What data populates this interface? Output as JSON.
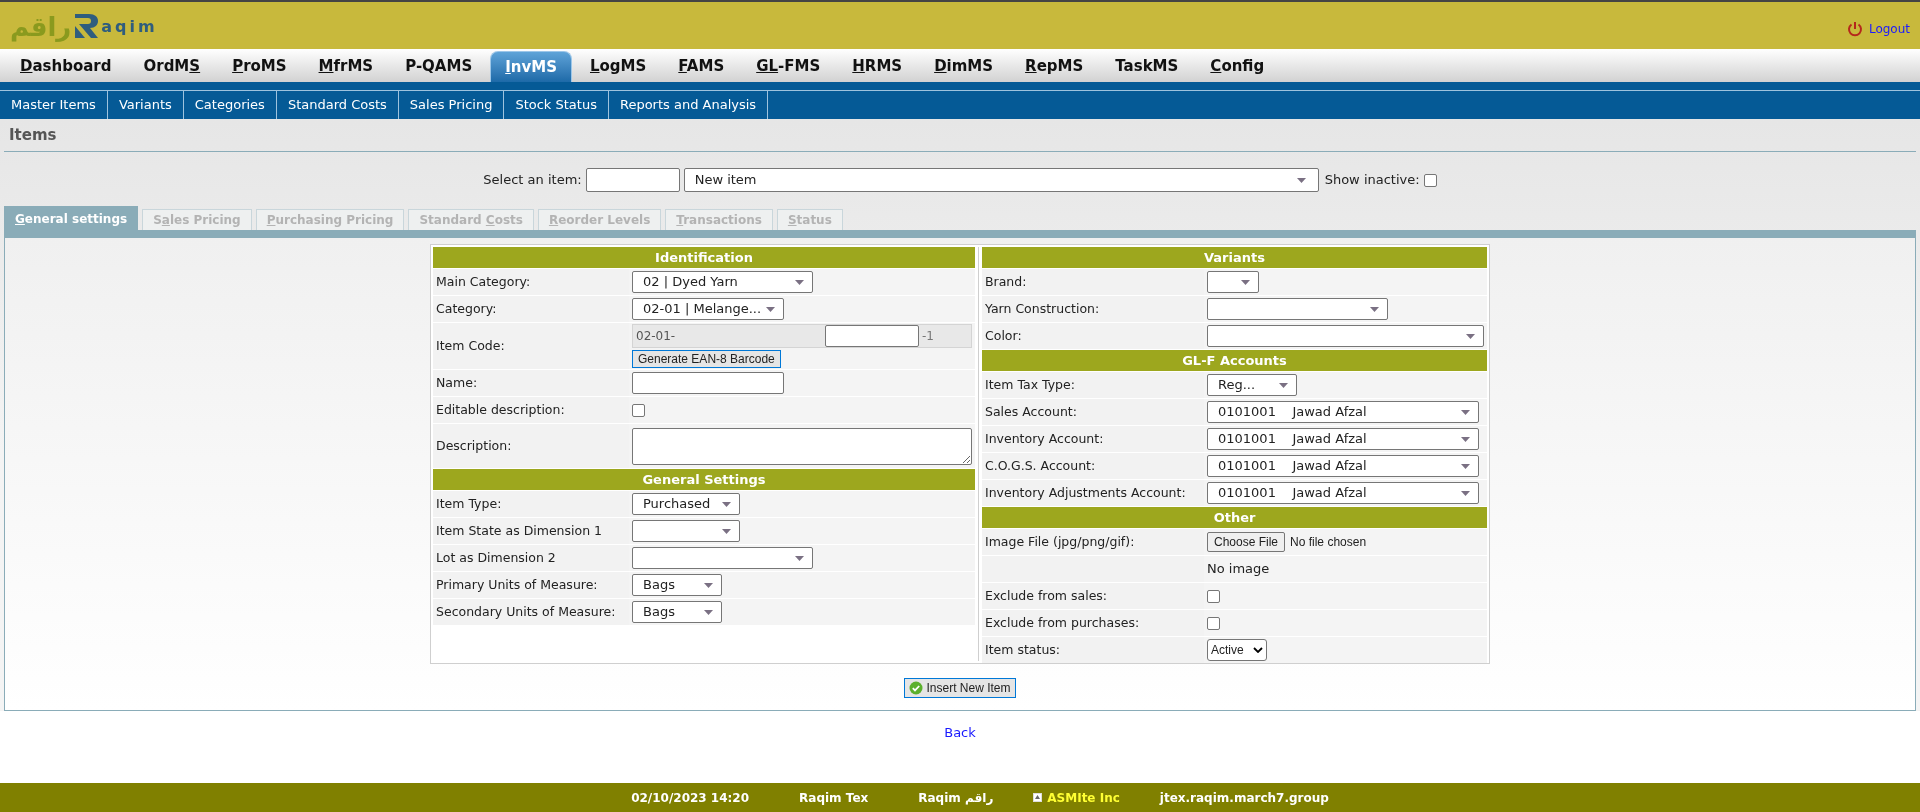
{
  "header": {
    "logo_arabic": "راقم",
    "logo_text": "aqim",
    "logout": "Logout"
  },
  "main_nav": [
    {
      "key": "D",
      "post": "ashboard",
      "selected": false
    },
    {
      "pre": "OrdM",
      "key": "S",
      "selected": false
    },
    {
      "key": "P",
      "post": "roMS",
      "selected": false
    },
    {
      "key": "M",
      "post": "frMS",
      "selected": false
    },
    {
      "pre": "P-QAMS",
      "selected": false
    },
    {
      "key": "I",
      "post": "nvMS",
      "selected": true
    },
    {
      "key": "L",
      "post": "ogMS",
      "selected": false
    },
    {
      "key": "F",
      "post": "AMS",
      "selected": false
    },
    {
      "key": "GL",
      "post": "-FMS",
      "selected": false
    },
    {
      "key": "H",
      "post": "RMS",
      "selected": false
    },
    {
      "key": "D",
      "post": "imMS",
      "selected": false
    },
    {
      "key": "R",
      "post": "epMS",
      "selected": false
    },
    {
      "pre": "TaskMS",
      "selected": false
    },
    {
      "key": "C",
      "post": "onfig",
      "selected": false
    }
  ],
  "sub_nav": [
    "Master Items",
    "Variants",
    "Categories",
    "Standard Costs",
    "Sales Pricing",
    "Stock Status",
    "Reports and Analysis"
  ],
  "page_title": "Items",
  "item_select": {
    "label": "Select an item:",
    "value": "New item",
    "show_inactive_label": "Show inactive:",
    "show_inactive_checked": false
  },
  "tabs": [
    {
      "key": "G",
      "post": "eneral settings",
      "selected": true,
      "disabled": false
    },
    {
      "pre": "S",
      "key": "a",
      "post": "les Pricing",
      "selected": false,
      "disabled": true
    },
    {
      "key": "P",
      "post": "urchasing Pricing",
      "selected": false,
      "disabled": true
    },
    {
      "pre": "Standard ",
      "key": "C",
      "post": "osts",
      "selected": false,
      "disabled": true
    },
    {
      "key": "R",
      "post": "eorder Levels",
      "selected": false,
      "disabled": true
    },
    {
      "key": "T",
      "post": "ransactions",
      "selected": false,
      "disabled": true
    },
    {
      "key": "S",
      "post": "tatus",
      "selected": false,
      "disabled": true
    }
  ],
  "form": {
    "columns": [
      [
        {
          "title": "Identification",
          "rows": [
            {
              "label": "Main Category:",
              "kind": "select",
              "value": "02 | Dyed Yarn"
            },
            {
              "label": "Category:",
              "kind": "select",
              "value": "02-01 | Melange..."
            },
            {
              "label": "Item Code:",
              "kind": "code",
              "prefix": "02-01-",
              "suffix": "-1",
              "button": "Generate EAN-8 Barcode"
            },
            {
              "label": "Name:",
              "kind": "text"
            },
            {
              "label": "Editable description:",
              "kind": "checkbox",
              "checked": false
            },
            {
              "label": "Description:",
              "kind": "textarea"
            }
          ]
        },
        {
          "title": "General Settings",
          "rows": [
            {
              "label": "Item Type:",
              "kind": "select",
              "value": "Purchased"
            },
            {
              "label": "Item State as Dimension 1",
              "kind": "select"
            },
            {
              "label": "Lot as Dimension 2",
              "kind": "select"
            },
            {
              "label": "Primary Units of Measure:",
              "kind": "select",
              "value": "Bags"
            },
            {
              "label": "Secondary Units of Measure:",
              "kind": "select",
              "value": "Bags"
            }
          ]
        }
      ],
      [
        {
          "title": "Variants",
          "rows": [
            {
              "label": "Brand:",
              "kind": "select"
            },
            {
              "label": "Yarn Construction:",
              "kind": "select"
            },
            {
              "label": "Color:",
              "kind": "select"
            }
          ]
        },
        {
          "title": "GL-F Accounts",
          "rows": [
            {
              "label": "Item Tax Type:",
              "kind": "select",
              "value": "Reg..."
            },
            {
              "label": "Sales Account:",
              "kind": "select",
              "value": "0101001    Jawad Afzal"
            },
            {
              "label": "Inventory Account:",
              "kind": "select",
              "value": "0101001    Jawad Afzal"
            },
            {
              "label": "C.O.G.S. Account:",
              "kind": "select",
              "value": "0101001    Jawad Afzal"
            },
            {
              "label": "Inventory Adjustments Account:",
              "kind": "select",
              "value": "0101001    Jawad Afzal"
            }
          ]
        },
        {
          "title": "Other",
          "rows": [
            {
              "label": "Image File (jpg/png/gif):",
              "kind": "file",
              "button": "Choose File",
              "status": "No file chosen"
            },
            {
              "kind": "note",
              "text": "No image"
            },
            {
              "label": "Exclude from sales:",
              "kind": "checkbox",
              "checked": false
            },
            {
              "label": "Exclude from purchases:",
              "kind": "checkbox",
              "checked": false
            },
            {
              "label": "Item status:",
              "kind": "native_select",
              "value": "Active"
            }
          ]
        }
      ]
    ]
  },
  "insert_button": "Insert New Item",
  "back_link": "Back",
  "footer": [
    {
      "text": "02/10/2023 14:20",
      "kind": "plain"
    },
    {
      "text": "Raqim Tex",
      "kind": "plain"
    },
    {
      "text": "Raqim راقم",
      "kind": "plain"
    },
    {
      "text": "ASMIte Inc",
      "kind": "brand"
    },
    {
      "text": "jtex.raqim.march7.group",
      "kind": "plain"
    }
  ]
}
